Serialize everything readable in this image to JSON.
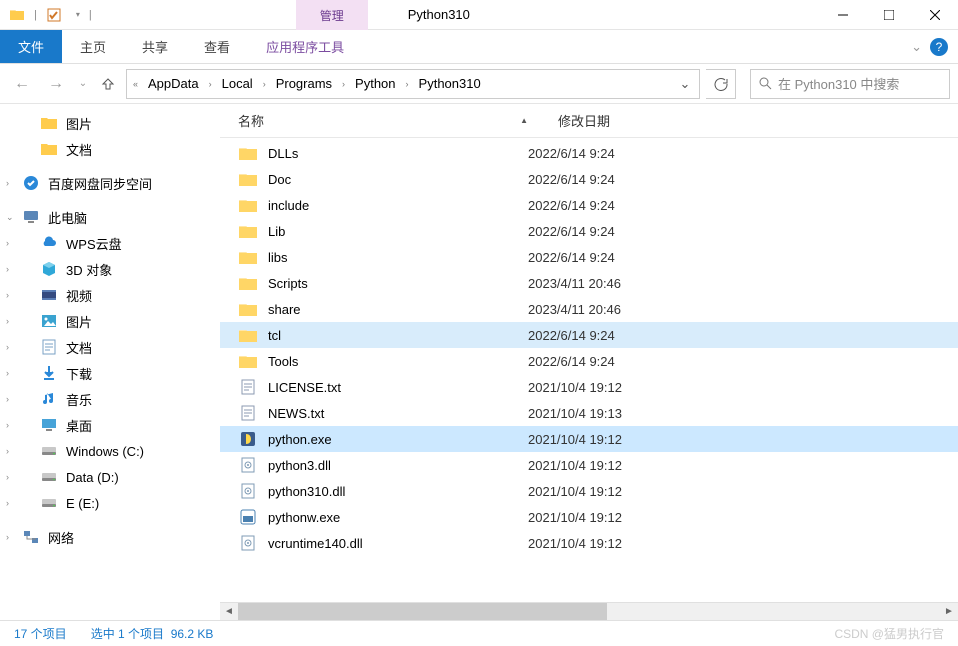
{
  "title": "Python310",
  "ribbon_tab_title": "管理",
  "ribbon": {
    "file": "文件",
    "tabs": [
      "主页",
      "共享",
      "查看"
    ],
    "contextual": "应用程序工具"
  },
  "breadcrumbs": [
    "AppData",
    "Local",
    "Programs",
    "Python",
    "Python310"
  ],
  "search": {
    "placeholder": "在 Python310 中搜索"
  },
  "sidebar": {
    "top": [
      {
        "label": "图片",
        "icon": "folder"
      },
      {
        "label": "文档",
        "icon": "folder"
      }
    ],
    "baidu": {
      "label": "百度网盘同步空间"
    },
    "thispc": {
      "label": "此电脑",
      "children": [
        {
          "label": "WPS云盘",
          "icon": "cloud"
        },
        {
          "label": "3D 对象",
          "icon": "3d"
        },
        {
          "label": "视频",
          "icon": "video"
        },
        {
          "label": "图片",
          "icon": "pic"
        },
        {
          "label": "文档",
          "icon": "doc"
        },
        {
          "label": "下载",
          "icon": "dl"
        },
        {
          "label": "音乐",
          "icon": "music"
        },
        {
          "label": "桌面",
          "icon": "desktop"
        },
        {
          "label": "Windows (C:)",
          "icon": "disk"
        },
        {
          "label": "Data (D:)",
          "icon": "disk"
        },
        {
          "label": "E (E:)",
          "icon": "disk"
        }
      ]
    },
    "network": {
      "label": "网络"
    }
  },
  "columns": {
    "name": "名称",
    "date": "修改日期"
  },
  "files": [
    {
      "name": "DLLs",
      "type": "folder",
      "date": "2022/6/14 9:24"
    },
    {
      "name": "Doc",
      "type": "folder",
      "date": "2022/6/14 9:24"
    },
    {
      "name": "include",
      "type": "folder",
      "date": "2022/6/14 9:24"
    },
    {
      "name": "Lib",
      "type": "folder",
      "date": "2022/6/14 9:24"
    },
    {
      "name": "libs",
      "type": "folder",
      "date": "2022/6/14 9:24"
    },
    {
      "name": "Scripts",
      "type": "folder",
      "date": "2023/4/11 20:46"
    },
    {
      "name": "share",
      "type": "folder",
      "date": "2023/4/11 20:46"
    },
    {
      "name": "tcl",
      "type": "folder",
      "date": "2022/6/14 9:24",
      "highlighted": true
    },
    {
      "name": "Tools",
      "type": "folder",
      "date": "2022/6/14 9:24"
    },
    {
      "name": "LICENSE.txt",
      "type": "txt",
      "date": "2021/10/4 19:12"
    },
    {
      "name": "NEWS.txt",
      "type": "txt",
      "date": "2021/10/4 19:13"
    },
    {
      "name": "python.exe",
      "type": "exe",
      "date": "2021/10/4 19:12",
      "selected": true
    },
    {
      "name": "python3.dll",
      "type": "dll",
      "date": "2021/10/4 19:12"
    },
    {
      "name": "python310.dll",
      "type": "dll",
      "date": "2021/10/4 19:12"
    },
    {
      "name": "pythonw.exe",
      "type": "exe2",
      "date": "2021/10/4 19:12"
    },
    {
      "name": "vcruntime140.dll",
      "type": "dll",
      "date": "2021/10/4 19:12"
    }
  ],
  "status": {
    "count": "17 个项目",
    "selection": "选中 1 个项目",
    "size": "96.2 KB"
  },
  "watermark": "CSDN @猛男执行官"
}
